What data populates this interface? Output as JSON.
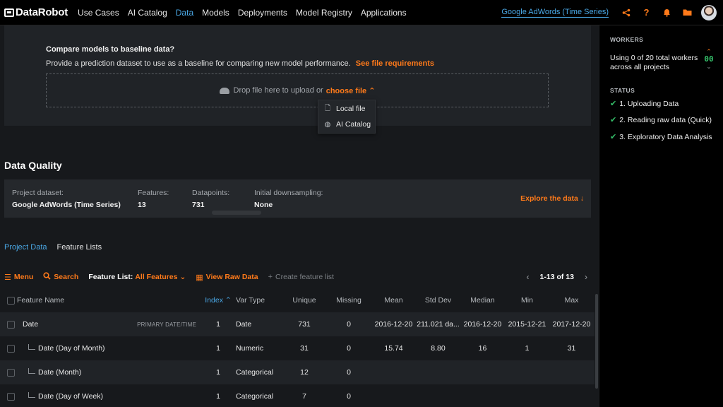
{
  "nav": {
    "brand": "DataRobot",
    "items": [
      "Use Cases",
      "AI Catalog",
      "Data",
      "Models",
      "Deployments",
      "Model Registry",
      "Applications"
    ],
    "active": "Data",
    "project_name": "Google AdWords (Time Series)",
    "icons": [
      "share-icon",
      "help-icon",
      "bell-icon",
      "folder-icon",
      "avatar"
    ]
  },
  "baseline": {
    "title": "Compare models to baseline data?",
    "description": "Provide a prediction dataset to use as a baseline for comparing new model performance.",
    "requirements_link": "See file requirements",
    "drop_text": "Drop file here to upload or",
    "choose_file": "choose file",
    "dropdown_items": [
      {
        "label": "Local file",
        "icon": "file-icon"
      },
      {
        "label": "AI Catalog",
        "icon": "globe-icon"
      }
    ]
  },
  "data_quality": {
    "title": "Data Quality",
    "project_dataset_label": "Project dataset:",
    "project_dataset_value": "Google AdWords (Time Series)",
    "features_label": "Features:",
    "features_value": "13",
    "datapoints_label": "Datapoints:",
    "datapoints_value": "731",
    "downsampling_label": "Initial downsampling:",
    "downsampling_value": "None",
    "explore_label": "Explore the data"
  },
  "tabs": [
    {
      "label": "Project Data",
      "active": true
    },
    {
      "label": "Feature Lists",
      "active": false
    }
  ],
  "toolbar": {
    "menu": "Menu",
    "search": "Search",
    "feature_list_label": "Feature List:",
    "feature_list_value": "All Features",
    "view_raw": "View Raw Data",
    "create_list": "Create feature list",
    "page_count": "1-13 of 13"
  },
  "table": {
    "headers": {
      "name": "Feature Name",
      "index": "Index",
      "vartype": "Var Type",
      "unique": "Unique",
      "missing": "Missing",
      "mean": "Mean",
      "std": "Std Dev",
      "median": "Median",
      "min": "Min",
      "max": "Max"
    },
    "rows": [
      {
        "name": "Date",
        "tag": "PRIMARY DATE/TIME",
        "child": false,
        "index": "1",
        "vartype": "Date",
        "unique": "731",
        "missing": "0",
        "mean": "2016-12-20",
        "std": "211.021 da...",
        "median": "2016-12-20",
        "min": "2015-12-21",
        "max": "2017-12-20"
      },
      {
        "name": "Date (Day of Month)",
        "tag": "",
        "child": true,
        "index": "1",
        "vartype": "Numeric",
        "unique": "31",
        "missing": "0",
        "mean": "15.74",
        "std": "8.80",
        "median": "16",
        "min": "1",
        "max": "31"
      },
      {
        "name": "Date (Month)",
        "tag": "",
        "child": true,
        "index": "1",
        "vartype": "Categorical",
        "unique": "12",
        "missing": "0",
        "mean": "",
        "std": "",
        "median": "",
        "min": "",
        "max": ""
      },
      {
        "name": "Date (Day of Week)",
        "tag": "",
        "child": true,
        "index": "1",
        "vartype": "Categorical",
        "unique": "7",
        "missing": "0",
        "mean": "",
        "std": "",
        "median": "",
        "min": "",
        "max": ""
      }
    ]
  },
  "side_panel": {
    "workers_heading": "WORKERS",
    "workers_text": "Using 0 of 20 total workers across all projects",
    "worker_count": "00",
    "status_heading": "STATUS",
    "steps": [
      "1. Uploading Data",
      "2. Reading raw data (Quick)",
      "3. Exploratory Data Analysis"
    ]
  },
  "colors": {
    "accent": "#ff7a1a",
    "link": "#4aa8e6",
    "success": "#35c06a"
  }
}
